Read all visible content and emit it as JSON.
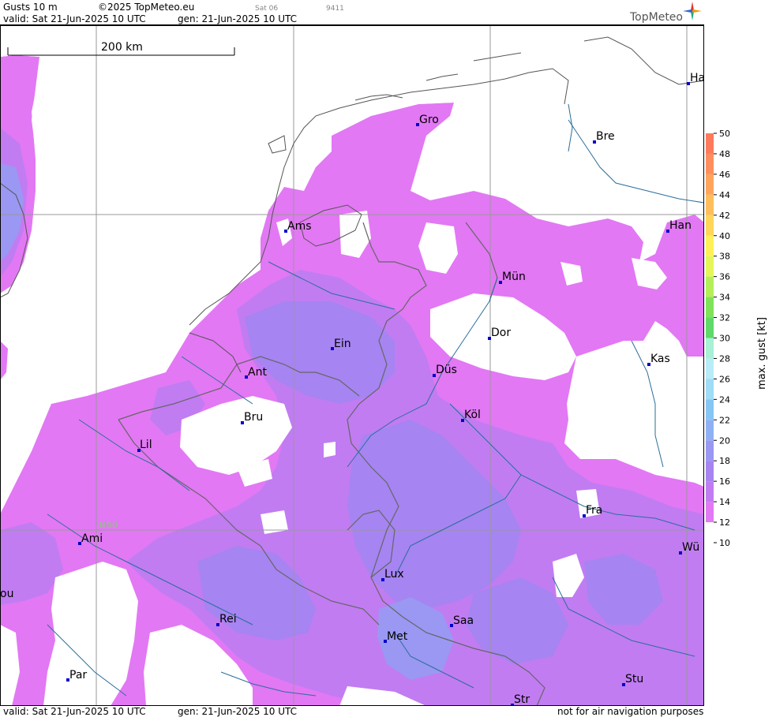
{
  "header": {
    "product": "Gusts 10 m",
    "copyright": "©2025 TopMeteo.eu",
    "valid": "valid:  Sat  21-Jun-2025  10 UTC",
    "gen": "gen: 21-Jun-2025 10 UTC",
    "sat_tag": "Sat 06",
    "code_tag": "9411",
    "logo_text": "TopMeteo"
  },
  "footer": {
    "valid": "valid:  Sat  21-Jun-2025  10 UTC",
    "gen": "gen: 21-Jun-2025 10 UTC",
    "note": "not for air navigation purposes"
  },
  "map": {
    "scale_label": "200 km",
    "parallel_label": "N50",
    "cities": [
      {
        "id": "gro",
        "label": "Gro"
      },
      {
        "id": "bre",
        "label": "Bre"
      },
      {
        "id": "ha",
        "label": "Ha"
      },
      {
        "id": "ams",
        "label": "Ams"
      },
      {
        "id": "han",
        "label": "Han"
      },
      {
        "id": "mun",
        "label": "Mün"
      },
      {
        "id": "dor",
        "label": "Dor"
      },
      {
        "id": "ein",
        "label": "Ein"
      },
      {
        "id": "kas",
        "label": "Kas"
      },
      {
        "id": "dus",
        "label": "Düs"
      },
      {
        "id": "ant",
        "label": "Ant"
      },
      {
        "id": "kol",
        "label": "Köl"
      },
      {
        "id": "bru",
        "label": "Bru"
      },
      {
        "id": "lil",
        "label": "Lil"
      },
      {
        "id": "fra",
        "label": "Fra"
      },
      {
        "id": "ami",
        "label": "Ami"
      },
      {
        "id": "wur",
        "label": "Wü"
      },
      {
        "id": "lux",
        "label": "Lux"
      },
      {
        "id": "ou",
        "label": "ou"
      },
      {
        "id": "rei",
        "label": "Rei"
      },
      {
        "id": "saa",
        "label": "Saa"
      },
      {
        "id": "met",
        "label": "Met"
      },
      {
        "id": "par",
        "label": "Par"
      },
      {
        "id": "stu",
        "label": "Stu"
      },
      {
        "id": "str",
        "label": "Str"
      }
    ]
  },
  "legend": {
    "title": "max. gust [kt]",
    "ticks": [
      "50",
      "48",
      "46",
      "44",
      "42",
      "40",
      "38",
      "36",
      "34",
      "32",
      "30",
      "28",
      "26",
      "24",
      "22",
      "20",
      "18",
      "16",
      "14",
      "12",
      "10"
    ],
    "bands": [
      {
        "min": 48,
        "max": 50,
        "color": "#ff7a5c"
      },
      {
        "min": 46,
        "max": 48,
        "color": "#ff8e5e"
      },
      {
        "min": 44,
        "max": 46,
        "color": "#ffa55e"
      },
      {
        "min": 42,
        "max": 44,
        "color": "#ffbe5c"
      },
      {
        "min": 40,
        "max": 42,
        "color": "#ffd65a"
      },
      {
        "min": 38,
        "max": 40,
        "color": "#fff05a"
      },
      {
        "min": 36,
        "max": 38,
        "color": "#e6f55a"
      },
      {
        "min": 34,
        "max": 36,
        "color": "#b4ef5a"
      },
      {
        "min": 32,
        "max": 34,
        "color": "#7fe35a"
      },
      {
        "min": 30,
        "max": 32,
        "color": "#5ed96a"
      },
      {
        "min": 28,
        "max": 30,
        "color": "#a8f0d6"
      },
      {
        "min": 26,
        "max": 28,
        "color": "#b8ecf6"
      },
      {
        "min": 24,
        "max": 26,
        "color": "#9fdcf6"
      },
      {
        "min": 22,
        "max": 24,
        "color": "#86c6f4"
      },
      {
        "min": 20,
        "max": 22,
        "color": "#8fb0f4"
      },
      {
        "min": 18,
        "max": 20,
        "color": "#9a98f2"
      },
      {
        "min": 16,
        "max": 18,
        "color": "#a684f2"
      },
      {
        "min": 14,
        "max": 16,
        "color": "#c17cf2"
      },
      {
        "min": 12,
        "max": 14,
        "color": "#e278f4"
      }
    ],
    "range": [
      10,
      50
    ]
  },
  "colors": {
    "gust_12_14": "#e278f4",
    "gust_14_16": "#c17cf2",
    "gust_16_18": "#a684f2",
    "gust_18_20": "#9a98f2",
    "no_gust": "#ffffff",
    "border": "#666666",
    "river": "#2a6e9a",
    "grid": "#999999",
    "city_marker": "#0000cc"
  }
}
